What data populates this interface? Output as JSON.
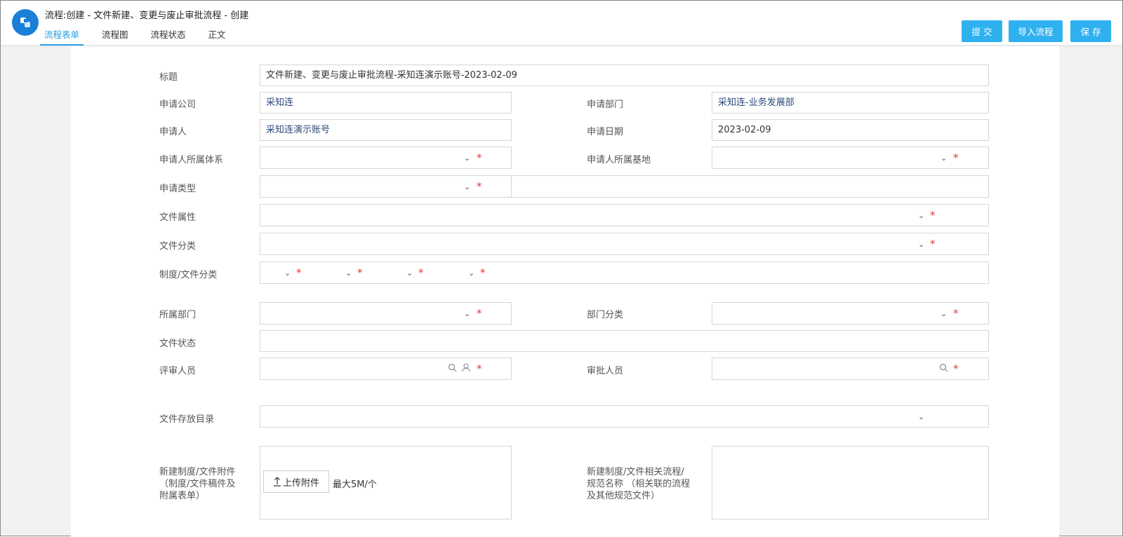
{
  "header": {
    "title": "流程:创建 - 文件新建、变更与废止审批流程 - 创建",
    "tabs": [
      "流程表单",
      "流程图",
      "流程状态",
      "正文"
    ],
    "buttons": {
      "submit": "提 交",
      "import": "导入流程",
      "save": "保 存"
    }
  },
  "form": {
    "title_label": "标题",
    "title_value": "文件新建、变更与废止审批流程-采知连演示账号-2023-02-09",
    "company_label": "申请公司",
    "company_value": "采知连",
    "dept_label": "申请部门",
    "dept_value": "采知连-业务发展部",
    "applicant_label": "申请人",
    "applicant_value": "采知连演示账号",
    "date_label": "申请日期",
    "date_value": "2023-02-09",
    "system_label": "申请人所属体系",
    "base_label": "申请人所属基地",
    "type_label": "申请类型",
    "attr_label": "文件属性",
    "category_label": "文件分类",
    "regcat_label": "制度/文件分类",
    "owndept_label": "所属部门",
    "deptcat_label": "部门分类",
    "status_label": "文件状态",
    "reviewer_label": "评审人员",
    "approver_label": "审批人员",
    "dir_label": "文件存放目录",
    "attach_label": "新建制度/文件附件 （制度/文件稿件及附属表单）",
    "upload_label": "上传附件",
    "upload_hint": "最大5M/个",
    "related_label": "新建制度/文件相关流程/规范名称 （相关联的流程及其他规范文件）"
  },
  "colors": {
    "accent": "#2fb1f0",
    "tab_active": "#29a0e6",
    "required": "#e53935",
    "logo": "#1a7fd6"
  }
}
